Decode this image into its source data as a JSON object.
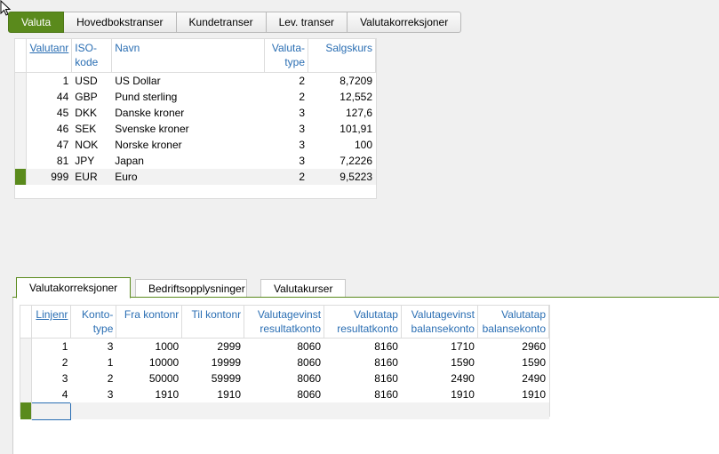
{
  "top_tabs": [
    "Valuta",
    "Hovedbokstranser",
    "Kundetranser",
    "Lev. transer",
    "Valutakorreksjoner"
  ],
  "currency_grid": {
    "headers": {
      "valutanr": "Valutanr",
      "iso_1": "ISO-",
      "iso_2": "kode",
      "navn": "Navn",
      "type_1": "Valuta-",
      "type_2": "type",
      "salgskurs": "Salgskurs"
    },
    "rows": [
      {
        "nr": "1",
        "iso": "USD",
        "navn": "US Dollar",
        "type": "2",
        "kurs": "8,7209"
      },
      {
        "nr": "44",
        "iso": "GBP",
        "navn": "Pund sterling",
        "type": "2",
        "kurs": "12,552"
      },
      {
        "nr": "45",
        "iso": "DKK",
        "navn": "Danske kroner",
        "type": "3",
        "kurs": "127,6"
      },
      {
        "nr": "46",
        "iso": "SEK",
        "navn": "Svenske kroner",
        "type": "3",
        "kurs": "101,91"
      },
      {
        "nr": "47",
        "iso": "NOK",
        "navn": "Norske kroner",
        "type": "3",
        "kurs": "100"
      },
      {
        "nr": "81",
        "iso": "JPY",
        "navn": "Japan",
        "type": "3",
        "kurs": "7,2226"
      },
      {
        "nr": "999",
        "iso": "EUR",
        "navn": "Euro",
        "type": "2",
        "kurs": "9,5223"
      }
    ]
  },
  "lower_tabs": [
    "Valutakorreksjoner",
    "Bedriftsopplysninger",
    "Valutakurser"
  ],
  "correction_grid": {
    "headers": {
      "linjenr": "Linjenr",
      "konto_1": "Konto-",
      "konto_2": "type",
      "fra": "Fra kontonr",
      "til": "Til kontonr",
      "vg_res_1": "Valutagevinst",
      "vg_res_2": "resultatkonto",
      "vt_res_1": "Valutatap",
      "vt_res_2": "resultatkonto",
      "vg_bal_1": "Valutagevinst",
      "vg_bal_2": "balansekonto",
      "vt_bal_1": "Valutatap",
      "vt_bal_2": "balansekonto"
    },
    "rows": [
      {
        "linje": "1",
        "type": "3",
        "fra": "1000",
        "til": "2999",
        "vgr": "8060",
        "vtr": "8160",
        "vgb": "1710",
        "vtb": "2960"
      },
      {
        "linje": "2",
        "type": "1",
        "fra": "10000",
        "til": "19999",
        "vgr": "8060",
        "vtr": "8160",
        "vgb": "1590",
        "vtb": "1590"
      },
      {
        "linje": "3",
        "type": "2",
        "fra": "50000",
        "til": "59999",
        "vgr": "8060",
        "vtr": "8160",
        "vgb": "2490",
        "vtb": "2490"
      },
      {
        "linje": "4",
        "type": "3",
        "fra": "1910",
        "til": "1910",
        "vgr": "8060",
        "vtr": "8160",
        "vgb": "1910",
        "vtb": "1910"
      }
    ]
  },
  "colors": {
    "accent": "#5a8a1c",
    "header_text": "#2a6eb3"
  },
  "icons": {
    "cursor": "mouse-pointer-icon"
  }
}
